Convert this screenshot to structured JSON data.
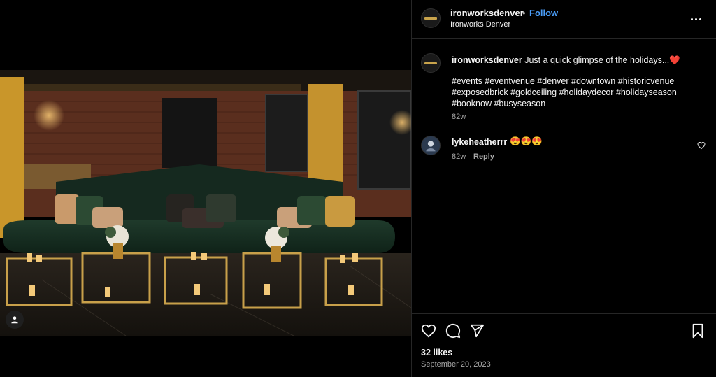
{
  "header": {
    "username": "ironworksdenver",
    "separator": "•",
    "follow_label": "Follow",
    "location": "Ironworks Denver",
    "more_icon": "more-horizontal-icon"
  },
  "caption": {
    "username": "ironworksdenver",
    "text": "Just a quick glimpse of the holidays...❤️",
    "hashtags": [
      "#events",
      "#eventvenue",
      "#denver",
      "#downtown",
      "#historicvenue",
      "#exposedbrick",
      "#goldceiling",
      "#holidaydecor",
      "#holidayseason",
      "#booknow",
      "#busyseason"
    ],
    "time": "82w"
  },
  "comment": {
    "username": "lykeheatherrr",
    "text": "😍😍😍",
    "time": "82w",
    "reply_label": "Reply"
  },
  "footer": {
    "likes": "32 likes",
    "date": "September 20, 2023"
  },
  "icons": {
    "like": "heart-icon",
    "comment": "comment-bubble-icon",
    "share": "paper-plane-icon",
    "save": "bookmark-icon",
    "tag": "user-tag-icon"
  },
  "colors": {
    "background": "#000000",
    "text": "#f5f5f5",
    "secondary": "#a8a8a8",
    "follow_blue": "#4a9df8",
    "divider": "#262626"
  }
}
